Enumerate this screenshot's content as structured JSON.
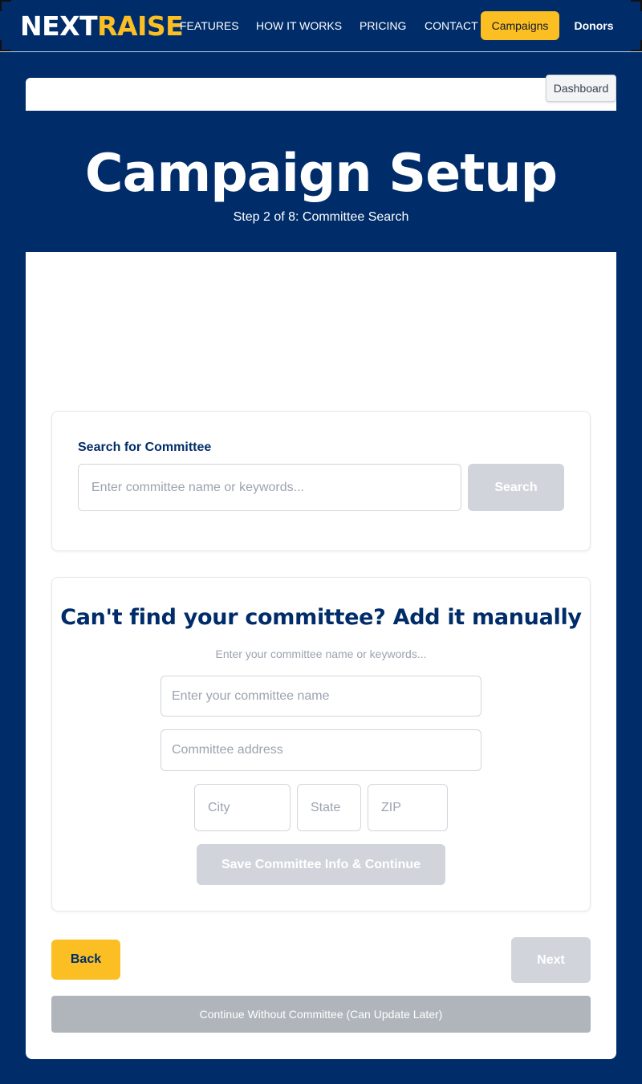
{
  "nav": {
    "logo_part1": "NEXT",
    "logo_part2": "RAISE",
    "links": [
      "FEATURES",
      "HOW IT WORKS",
      "PRICING",
      "CONTACT"
    ],
    "campaigns_label": "Campaigns",
    "donors_label": "Donors"
  },
  "header": {
    "dashboard_label": "Dashboard",
    "title": "Campaign Setup",
    "step": "Step 2 of 8: Committee Search"
  },
  "search": {
    "label": "Search for Committee",
    "placeholder": "Enter committee name or keywords...",
    "button_label": "Search"
  },
  "manual": {
    "title": "Can't find your committee? Add it manually",
    "hint": "Enter your committee name or keywords...",
    "name_placeholder": "Enter your committee name",
    "address_placeholder": "Committee address",
    "city_placeholder": "City",
    "state_placeholder": "State",
    "zip_placeholder": "ZIP",
    "save_label": "Save Committee Info & Continue"
  },
  "footer": {
    "back_label": "Back",
    "next_label": "Next",
    "continue_label": "Continue Without Committee (Can Update Later)"
  },
  "colors": {
    "brand_navy": "#002d6a",
    "accent_yellow": "#fbbf24",
    "disabled_gray": "#d1d5db"
  }
}
